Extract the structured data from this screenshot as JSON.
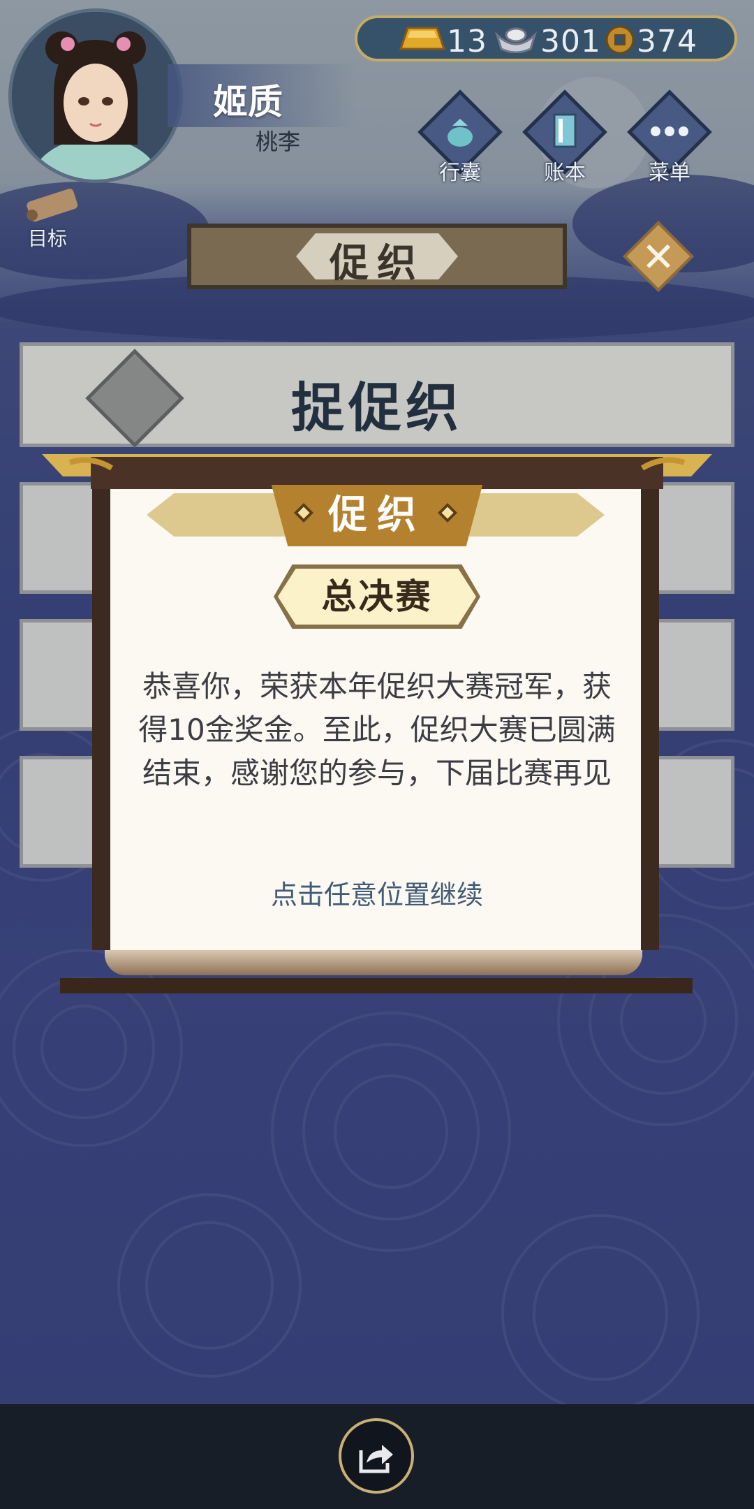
{
  "player": {
    "name": "姬质",
    "title": "桃李"
  },
  "currency": {
    "gold": "13",
    "silver": "301",
    "coins": "374"
  },
  "menu": [
    {
      "label": "行囊",
      "icon": "bag-icon"
    },
    {
      "label": "账本",
      "icon": "ledger-icon"
    },
    {
      "label": "菜单",
      "icon": "more-icon"
    }
  ],
  "goal": {
    "label": "目标"
  },
  "page": {
    "title": "促织"
  },
  "card_main": {
    "title": "捉促织"
  },
  "modal": {
    "title": "促织",
    "stage": "总决赛",
    "message": "恭喜你，荣获本年促织大赛冠军，获得10金奖金。至此，促织大赛已圆满结束，感谢您的参与，下届比赛再见",
    "hint": "点击任意位置继续"
  },
  "colors": {
    "gold_accent": "#c4ac66",
    "panel_paper": "#fbf9f1",
    "hint_text": "#415a77"
  }
}
